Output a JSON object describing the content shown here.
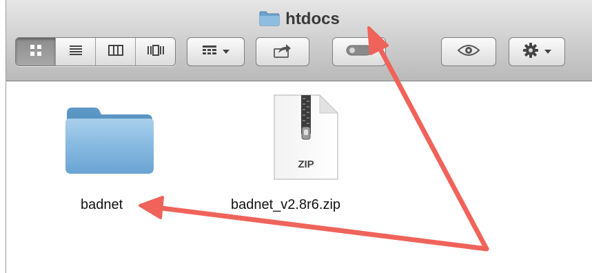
{
  "window": {
    "title": "htdocs"
  },
  "toolbar": {
    "view_buttons": [
      {
        "icon": "icon-view-icon",
        "active": true
      },
      {
        "icon": "list-view-icon",
        "active": false
      },
      {
        "icon": "column-view-icon",
        "active": false
      },
      {
        "icon": "coverflow-view-icon",
        "active": false
      }
    ],
    "arrange_icon": "arrange-icon",
    "share_icon": "share-icon",
    "tags_icon": "tags-icon",
    "quicklook_icon": "eye-icon",
    "action_icon": "gear-icon"
  },
  "files": [
    {
      "name": "badnet",
      "type": "folder",
      "icon": "folder-icon"
    },
    {
      "name": "badnet_v2.8r6.zip",
      "type": "zip",
      "icon": "zip-file-icon",
      "badge": "ZIP"
    }
  ],
  "annotation_color": "#f0635a"
}
